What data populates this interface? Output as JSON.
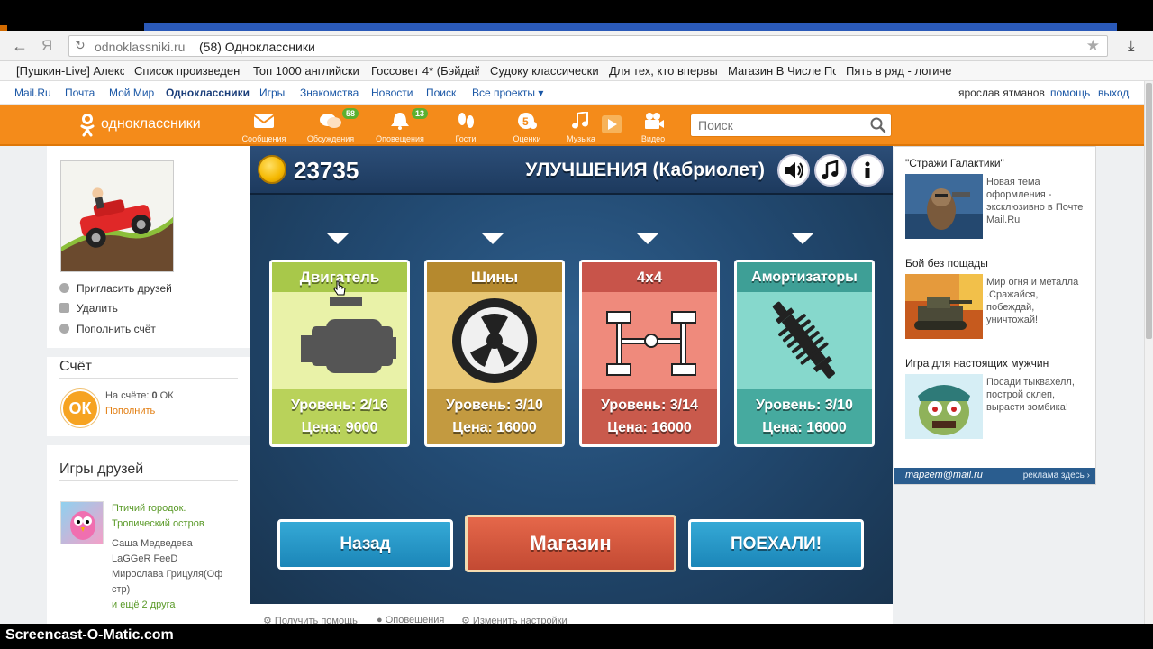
{
  "browser": {
    "ya_label": "Я",
    "url_domain": "odnoklassniki.ru",
    "page_title": "(58) Одноклассники"
  },
  "bookmarks": [
    "[Пушкин-Live] Алекс",
    "Список произведен",
    "Топ 1000 английски",
    "Госсовет 4* (Бэйдай",
    "Судоку классически",
    "Для тех, кто впервы",
    "Магазин В Числе Пс",
    "Пять в ряд - логиче"
  ],
  "mailbar": {
    "links": [
      "Mail.Ru",
      "Почта",
      "Мой Мир",
      "Одноклассники",
      "Игры",
      "Знакомства",
      "Новости",
      "Поиск",
      "Все проекты ▾"
    ],
    "user": "ярослав ятманов",
    "help": "помощь",
    "logout": "выход"
  },
  "ok": {
    "brand": "одноклассники",
    "nav": [
      {
        "label": "Сообщения",
        "icon": "envelope-icon"
      },
      {
        "label": "Обсуждения",
        "icon": "chat-bubbles-icon",
        "badge": "58"
      },
      {
        "label": "Оповещения",
        "icon": "bell-icon",
        "badge": "13"
      },
      {
        "label": "Гости",
        "icon": "footprints-icon"
      },
      {
        "label": "Оценки",
        "icon": "rating-5-icon"
      },
      {
        "label": "Музыка",
        "icon": "music-note-icon"
      },
      {
        "label": "Видео",
        "icon": "video-camera-icon"
      }
    ],
    "search_placeholder": "Поиск"
  },
  "left": {
    "actions": [
      "Пригласить друзей",
      "Удалить",
      "Пополнить счёт"
    ],
    "account_title": "Счёт",
    "balance_prefix": "На счёте: ",
    "balance_value": "0",
    "balance_unit": " ОК",
    "topup": "Пополнить",
    "friends_games_title": "Игры друзей",
    "game_name_line1": "Птичий городок.",
    "game_name_line2": "Тропический остров",
    "friends": [
      "Саша Медведева",
      "LaGGeR FeeD",
      "Мирослава Грицуля(Оф",
      "стр)"
    ],
    "more_friends": "и ещё 2 друга"
  },
  "game": {
    "coins": "23735",
    "title": "УЛУЧШЕНИЯ (Кабриолет)",
    "cards": [
      {
        "name": "Двигатель",
        "level": "Уровень: 2/16",
        "price": "Цена: 9000",
        "hdr": "#a8c84a",
        "body": "#e9f2a8",
        "foot": "#b9d25a"
      },
      {
        "name": "Шины",
        "level": "Уровень: 3/10",
        "price": "Цена: 16000",
        "hdr": "#b5892e",
        "body": "#e8c774",
        "foot": "#c39a40"
      },
      {
        "name": "4x4",
        "level": "Уровень: 3/14",
        "price": "Цена: 16000",
        "hdr": "#c8544a",
        "body": "#ef8a7c",
        "foot": "#c95a4c"
      },
      {
        "name": "Амортизаторы",
        "level": "Уровень: 3/10",
        "price": "Цена: 16000",
        "hdr": "#3e9f96",
        "body": "#86d8cc",
        "foot": "#46aa9f"
      }
    ],
    "back": "Назад",
    "shop": "Магазин",
    "go": "ПОЕХАЛИ!"
  },
  "footer_links": [
    "Получить помощь",
    "Оповещения",
    "Изменить настройки"
  ],
  "ads": [
    {
      "title": "\"Стражи Галактики\"",
      "text": "Новая тема оформления - эксклюзивно в Почте Mail.Ru"
    },
    {
      "title": "Бой без пощады",
      "text": "Мир огня и металла .Сражайся, побеждай, уничтожай!"
    },
    {
      "title": "Игра для настоящих мужчин",
      "text": "Посади тыквахелл, построй склеп, вырасти зомбика!"
    }
  ],
  "ad_footer_left": "таргет@mail.ru",
  "ad_footer_right": "реклама здесь ›",
  "watermark": "Screencast-O-Matic.com"
}
